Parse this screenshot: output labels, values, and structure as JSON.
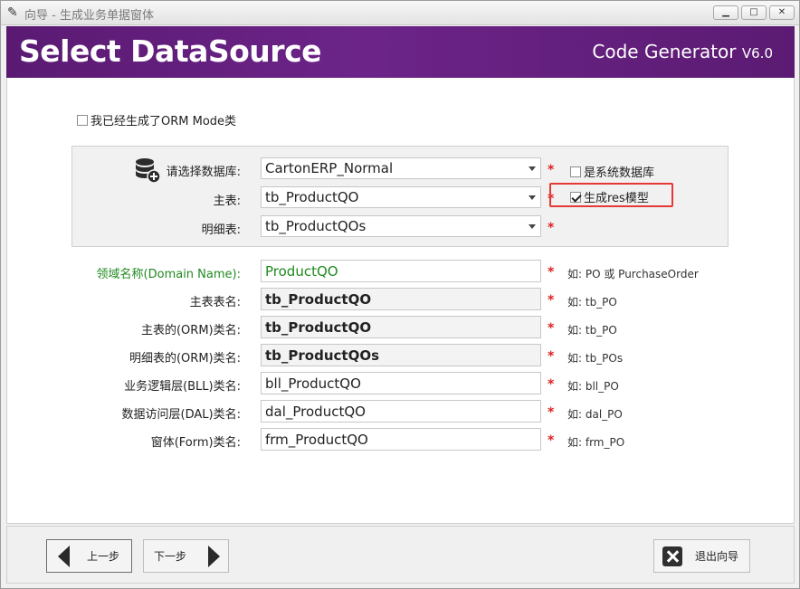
{
  "window": {
    "title": "向导 - 生成业务单据窗体",
    "minimize_icon": "minimize-icon",
    "maximize_icon": "maximize-icon",
    "close_icon": "close-icon"
  },
  "banner": {
    "title": "Select DataSource",
    "brand": "Code Generator",
    "version": "V6.0"
  },
  "orm_generated": {
    "label": "我已经生成了ORM Mode类",
    "checked": false
  },
  "datasource": {
    "database_label": "请选择数据库:",
    "database_value": "CartonERP_Normal",
    "main_table_label": "主表:",
    "main_table_value": "tb_ProductQO",
    "detail_table_label": "明细表:",
    "detail_table_value": "tb_ProductQOs",
    "is_system_db": {
      "label": "是系统数据库",
      "checked": false
    },
    "generate_res": {
      "label": "生成res模型",
      "checked": true
    }
  },
  "fields": [
    {
      "label": "领域名称(Domain Name):",
      "value": "ProductQO",
      "hint": "如: PO 或 PurchaseOrder",
      "style": "green"
    },
    {
      "label": "主表表名:",
      "value": "tb_ProductQO",
      "hint": "如: tb_PO",
      "style": "ro"
    },
    {
      "label": "主表的(ORM)类名:",
      "value": "tb_ProductQO",
      "hint": "如: tb_PO",
      "style": "ro"
    },
    {
      "label": "明细表的(ORM)类名:",
      "value": "tb_ProductQOs",
      "hint": "如: tb_POs",
      "style": "ro"
    },
    {
      "label": "业务逻辑层(BLL)类名:",
      "value": "bll_ProductQO",
      "hint": "如: bll_PO",
      "style": "normal"
    },
    {
      "label": "数据访问层(DAL)类名:",
      "value": "dal_ProductQO",
      "hint": "如: dal_PO",
      "style": "normal"
    },
    {
      "label": "窗体(Form)类名:",
      "value": "frm_ProductQO",
      "hint": "如: frm_PO",
      "style": "normal"
    }
  ],
  "required_mark": "*",
  "footer": {
    "prev_label": "上一步",
    "next_label": "下一步",
    "exit_label": "退出向导"
  },
  "colors": {
    "banner": "#5a1a72",
    "required": "#e02020",
    "domain_text": "#1f8a1f",
    "highlight": "#e53935"
  }
}
